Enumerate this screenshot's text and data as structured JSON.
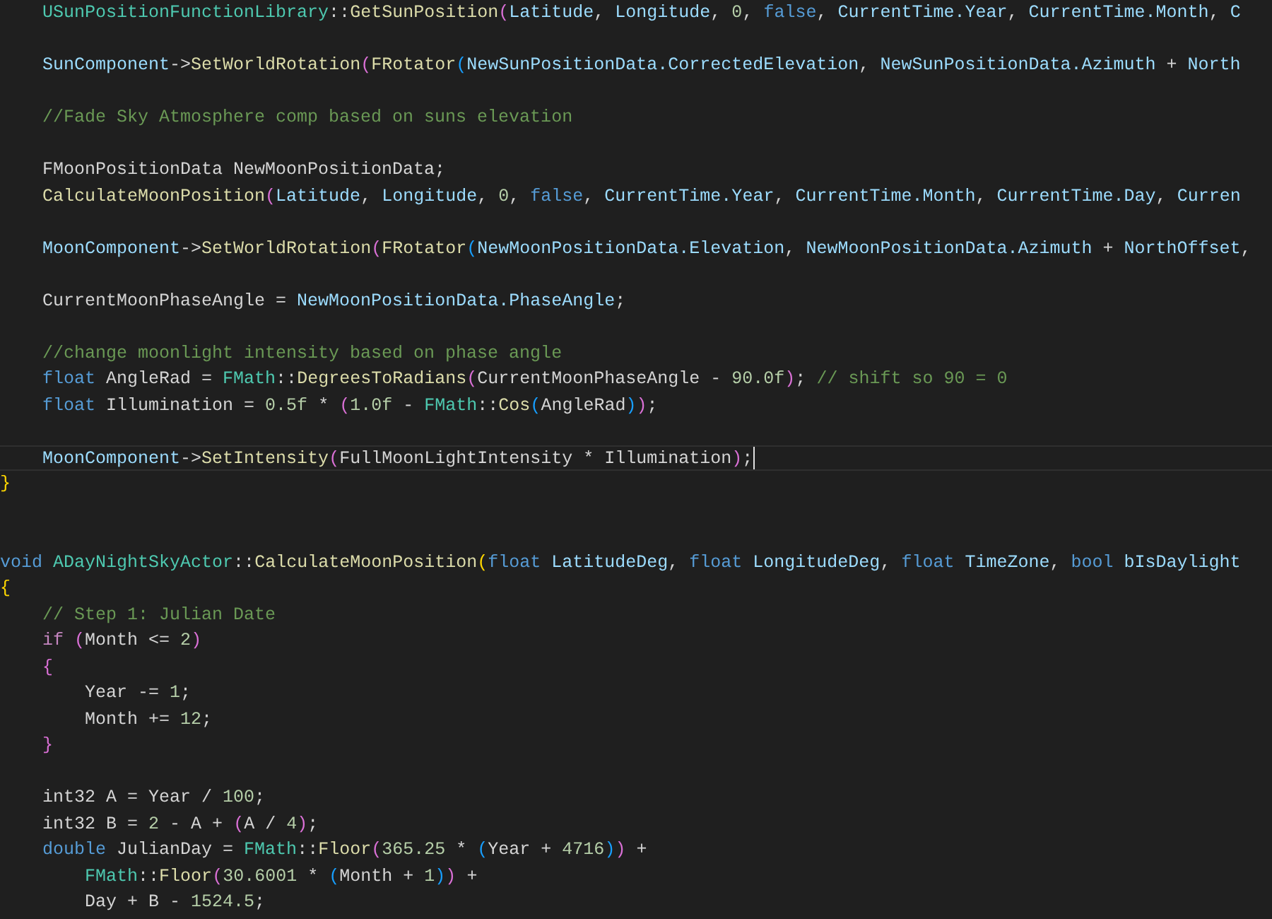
{
  "editor": {
    "lines": [
      {
        "kind": "code",
        "tokens": [
          {
            "text": "    USunPositionFunctionLibrary",
            "kind": "type"
          },
          {
            "text": "::",
            "kind": "plain"
          },
          {
            "text": "GetSunPosition",
            "kind": "function"
          },
          {
            "text": "(",
            "kind": "bracket-pink"
          },
          {
            "text": "Latitude",
            "kind": "variable"
          },
          {
            "text": ", ",
            "kind": "plain"
          },
          {
            "text": "Longitude",
            "kind": "variable"
          },
          {
            "text": ", ",
            "kind": "plain"
          },
          {
            "text": "0",
            "kind": "number"
          },
          {
            "text": ", ",
            "kind": "plain"
          },
          {
            "text": "false",
            "kind": "keyword"
          },
          {
            "text": ", ",
            "kind": "plain"
          },
          {
            "text": "CurrentTime.Year",
            "kind": "variable"
          },
          {
            "text": ", ",
            "kind": "plain"
          },
          {
            "text": "CurrentTime.Month",
            "kind": "variable"
          },
          {
            "text": ", ",
            "kind": "plain"
          },
          {
            "text": "C",
            "kind": "variable"
          }
        ]
      },
      {
        "kind": "blank"
      },
      {
        "kind": "code",
        "tokens": [
          {
            "text": "    SunComponent",
            "kind": "variable"
          },
          {
            "text": "->",
            "kind": "plain"
          },
          {
            "text": "SetWorldRotation",
            "kind": "function"
          },
          {
            "text": "(",
            "kind": "bracket-pink"
          },
          {
            "text": "FRotator",
            "kind": "function"
          },
          {
            "text": "(",
            "kind": "bracket-blue"
          },
          {
            "text": "NewSunPositionData.CorrectedElevation",
            "kind": "variable"
          },
          {
            "text": ", ",
            "kind": "plain"
          },
          {
            "text": "NewSunPositionData.Azimuth",
            "kind": "variable"
          },
          {
            "text": " + ",
            "kind": "plain"
          },
          {
            "text": "North",
            "kind": "variable"
          }
        ]
      },
      {
        "kind": "blank"
      },
      {
        "kind": "code",
        "tokens": [
          {
            "text": "    //Fade Sky Atmosphere comp based on suns elevation",
            "kind": "comment"
          }
        ]
      },
      {
        "kind": "blank"
      },
      {
        "kind": "code",
        "tokens": [
          {
            "text": "    FMoonPositionData NewMoonPositionData;",
            "kind": "plain"
          }
        ]
      },
      {
        "kind": "code",
        "tokens": [
          {
            "text": "    CalculateMoonPosition",
            "kind": "function"
          },
          {
            "text": "(",
            "kind": "bracket-pink"
          },
          {
            "text": "Latitude",
            "kind": "variable"
          },
          {
            "text": ", ",
            "kind": "plain"
          },
          {
            "text": "Longitude",
            "kind": "variable"
          },
          {
            "text": ", ",
            "kind": "plain"
          },
          {
            "text": "0",
            "kind": "number"
          },
          {
            "text": ", ",
            "kind": "plain"
          },
          {
            "text": "false",
            "kind": "keyword"
          },
          {
            "text": ", ",
            "kind": "plain"
          },
          {
            "text": "CurrentTime.Year",
            "kind": "variable"
          },
          {
            "text": ", ",
            "kind": "plain"
          },
          {
            "text": "CurrentTime.Month",
            "kind": "variable"
          },
          {
            "text": ", ",
            "kind": "plain"
          },
          {
            "text": "CurrentTime.Day",
            "kind": "variable"
          },
          {
            "text": ", ",
            "kind": "plain"
          },
          {
            "text": "Curren",
            "kind": "variable"
          }
        ]
      },
      {
        "kind": "blank"
      },
      {
        "kind": "code",
        "tokens": [
          {
            "text": "    MoonComponent",
            "kind": "variable"
          },
          {
            "text": "->",
            "kind": "plain"
          },
          {
            "text": "SetWorldRotation",
            "kind": "function"
          },
          {
            "text": "(",
            "kind": "bracket-pink"
          },
          {
            "text": "FRotator",
            "kind": "function"
          },
          {
            "text": "(",
            "kind": "bracket-blue"
          },
          {
            "text": "NewMoonPositionData.Elevation",
            "kind": "variable"
          },
          {
            "text": ", ",
            "kind": "plain"
          },
          {
            "text": "NewMoonPositionData.Azimuth",
            "kind": "variable"
          },
          {
            "text": " + ",
            "kind": "plain"
          },
          {
            "text": "NorthOffset",
            "kind": "variable"
          },
          {
            "text": ",",
            "kind": "plain"
          }
        ]
      },
      {
        "kind": "blank"
      },
      {
        "kind": "code",
        "tokens": [
          {
            "text": "    CurrentMoonPhaseAngle = ",
            "kind": "plain"
          },
          {
            "text": "NewMoonPositionData.PhaseAngle",
            "kind": "variable"
          },
          {
            "text": ";",
            "kind": "plain"
          }
        ]
      },
      {
        "kind": "blank"
      },
      {
        "kind": "code",
        "tokens": [
          {
            "text": "    //change moonlight intensity based on phase angle",
            "kind": "comment"
          }
        ]
      },
      {
        "kind": "code",
        "tokens": [
          {
            "text": "    float",
            "kind": "keyword"
          },
          {
            "text": " AngleRad = ",
            "kind": "plain"
          },
          {
            "text": "FMath",
            "kind": "type"
          },
          {
            "text": "::",
            "kind": "plain"
          },
          {
            "text": "DegreesToRadians",
            "kind": "function"
          },
          {
            "text": "(",
            "kind": "bracket-pink"
          },
          {
            "text": "CurrentMoonPhaseAngle - ",
            "kind": "plain"
          },
          {
            "text": "90.0f",
            "kind": "number"
          },
          {
            "text": ")",
            "kind": "bracket-pink"
          },
          {
            "text": "; ",
            "kind": "plain"
          },
          {
            "text": "// shift so 90 = 0",
            "kind": "comment"
          }
        ]
      },
      {
        "kind": "code",
        "tokens": [
          {
            "text": "    float",
            "kind": "keyword"
          },
          {
            "text": " Illumination = ",
            "kind": "plain"
          },
          {
            "text": "0.5f",
            "kind": "number"
          },
          {
            "text": " * ",
            "kind": "plain"
          },
          {
            "text": "(",
            "kind": "bracket-pink"
          },
          {
            "text": "1.0f",
            "kind": "number"
          },
          {
            "text": " - ",
            "kind": "plain"
          },
          {
            "text": "FMath",
            "kind": "type"
          },
          {
            "text": "::",
            "kind": "plain"
          },
          {
            "text": "Cos",
            "kind": "function"
          },
          {
            "text": "(",
            "kind": "bracket-blue"
          },
          {
            "text": "AngleRad",
            "kind": "plain"
          },
          {
            "text": ")",
            "kind": "bracket-blue"
          },
          {
            "text": ")",
            "kind": "bracket-pink"
          },
          {
            "text": ";",
            "kind": "plain"
          }
        ]
      },
      {
        "kind": "blank"
      },
      {
        "kind": "code",
        "current": true,
        "cursor": true,
        "tokens": [
          {
            "text": "    MoonComponent",
            "kind": "variable"
          },
          {
            "text": "->",
            "kind": "plain"
          },
          {
            "text": "SetIntensity",
            "kind": "function"
          },
          {
            "text": "(",
            "kind": "bracket-pink"
          },
          {
            "text": "FullMoonLightIntensity * Illumination",
            "kind": "plain"
          },
          {
            "text": ")",
            "kind": "bracket-pink"
          },
          {
            "text": ";",
            "kind": "plain"
          }
        ]
      },
      {
        "kind": "code",
        "tokens": [
          {
            "text": "}",
            "kind": "bracket-gold"
          }
        ]
      },
      {
        "kind": "blank"
      },
      {
        "kind": "blank"
      },
      {
        "kind": "code",
        "tokens": [
          {
            "text": "void ",
            "kind": "keyword"
          },
          {
            "text": "ADayNightSkyActor",
            "kind": "type"
          },
          {
            "text": "::",
            "kind": "plain"
          },
          {
            "text": "CalculateMoonPosition",
            "kind": "function"
          },
          {
            "text": "(",
            "kind": "bracket-gold"
          },
          {
            "text": "float ",
            "kind": "keyword"
          },
          {
            "text": "LatitudeDeg",
            "kind": "variable"
          },
          {
            "text": ", ",
            "kind": "plain"
          },
          {
            "text": "float ",
            "kind": "keyword"
          },
          {
            "text": "LongitudeDeg",
            "kind": "variable"
          },
          {
            "text": ", ",
            "kind": "plain"
          },
          {
            "text": "float ",
            "kind": "keyword"
          },
          {
            "text": "TimeZone",
            "kind": "variable"
          },
          {
            "text": ", ",
            "kind": "plain"
          },
          {
            "text": "bool ",
            "kind": "keyword"
          },
          {
            "text": "bIsDaylight",
            "kind": "variable"
          }
        ]
      },
      {
        "kind": "code",
        "tokens": [
          {
            "text": "{",
            "kind": "bracket-gold"
          }
        ]
      },
      {
        "kind": "code",
        "tokens": [
          {
            "text": "    // Step 1: Julian Date",
            "kind": "comment"
          }
        ]
      },
      {
        "kind": "code",
        "tokens": [
          {
            "text": "    if ",
            "kind": "control"
          },
          {
            "text": "(",
            "kind": "bracket-pink"
          },
          {
            "text": "Month <= ",
            "kind": "plain"
          },
          {
            "text": "2",
            "kind": "number"
          },
          {
            "text": ")",
            "kind": "bracket-pink"
          }
        ]
      },
      {
        "kind": "code",
        "tokens": [
          {
            "text": "    {",
            "kind": "bracket-pink"
          }
        ]
      },
      {
        "kind": "code",
        "tokens": [
          {
            "text": "        Year -= ",
            "kind": "plain"
          },
          {
            "text": "1",
            "kind": "number"
          },
          {
            "text": ";",
            "kind": "plain"
          }
        ]
      },
      {
        "kind": "code",
        "tokens": [
          {
            "text": "        Month += ",
            "kind": "plain"
          },
          {
            "text": "12",
            "kind": "number"
          },
          {
            "text": ";",
            "kind": "plain"
          }
        ]
      },
      {
        "kind": "code",
        "tokens": [
          {
            "text": "    }",
            "kind": "bracket-pink"
          }
        ]
      },
      {
        "kind": "blank"
      },
      {
        "kind": "code",
        "tokens": [
          {
            "text": "    int32 A = Year / ",
            "kind": "plain"
          },
          {
            "text": "100",
            "kind": "number"
          },
          {
            "text": ";",
            "kind": "plain"
          }
        ]
      },
      {
        "kind": "code",
        "tokens": [
          {
            "text": "    int32 B = ",
            "kind": "plain"
          },
          {
            "text": "2",
            "kind": "number"
          },
          {
            "text": " - A + ",
            "kind": "plain"
          },
          {
            "text": "(",
            "kind": "bracket-pink"
          },
          {
            "text": "A / ",
            "kind": "plain"
          },
          {
            "text": "4",
            "kind": "number"
          },
          {
            "text": ")",
            "kind": "bracket-pink"
          },
          {
            "text": ";",
            "kind": "plain"
          }
        ]
      },
      {
        "kind": "code",
        "tokens": [
          {
            "text": "    double",
            "kind": "keyword"
          },
          {
            "text": " JulianDay = ",
            "kind": "plain"
          },
          {
            "text": "FMath",
            "kind": "type"
          },
          {
            "text": "::",
            "kind": "plain"
          },
          {
            "text": "Floor",
            "kind": "function"
          },
          {
            "text": "(",
            "kind": "bracket-pink"
          },
          {
            "text": "365.25",
            "kind": "number"
          },
          {
            "text": " * ",
            "kind": "plain"
          },
          {
            "text": "(",
            "kind": "bracket-blue"
          },
          {
            "text": "Year + ",
            "kind": "plain"
          },
          {
            "text": "4716",
            "kind": "number"
          },
          {
            "text": ")",
            "kind": "bracket-blue"
          },
          {
            "text": ")",
            "kind": "bracket-pink"
          },
          {
            "text": " +",
            "kind": "plain"
          }
        ]
      },
      {
        "kind": "code",
        "tokens": [
          {
            "text": "        FMath",
            "kind": "type"
          },
          {
            "text": "::",
            "kind": "plain"
          },
          {
            "text": "Floor",
            "kind": "function"
          },
          {
            "text": "(",
            "kind": "bracket-pink"
          },
          {
            "text": "30.6001",
            "kind": "number"
          },
          {
            "text": " * ",
            "kind": "plain"
          },
          {
            "text": "(",
            "kind": "bracket-blue"
          },
          {
            "text": "Month + ",
            "kind": "plain"
          },
          {
            "text": "1",
            "kind": "number"
          },
          {
            "text": ")",
            "kind": "bracket-blue"
          },
          {
            "text": ")",
            "kind": "bracket-pink"
          },
          {
            "text": " +",
            "kind": "plain"
          }
        ]
      },
      {
        "kind": "code",
        "tokens": [
          {
            "text": "        Day + B - ",
            "kind": "plain"
          },
          {
            "text": "1524.5",
            "kind": "number"
          },
          {
            "text": ";",
            "kind": "plain"
          }
        ]
      }
    ]
  }
}
